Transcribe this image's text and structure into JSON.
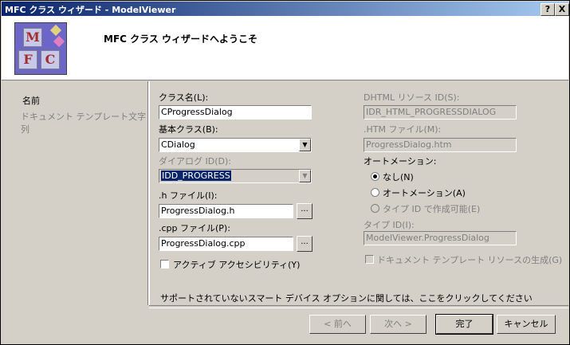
{
  "window": {
    "title": "MFC クラス ウィザード - ModelViewer",
    "help_button": "?",
    "close_button": "X"
  },
  "header": {
    "welcome": "MFC クラス ウィザードへようこそ",
    "logo_letters": [
      "M",
      "F",
      "C"
    ]
  },
  "sidebar": {
    "items": [
      {
        "label": "名前"
      },
      {
        "label": "ドキュメント テンプレート文字列"
      }
    ]
  },
  "form": {
    "class_name_label": "クラス名(L):",
    "class_name_value": "CProgressDialog",
    "base_class_label": "基本クラス(B):",
    "base_class_value": "CDialog",
    "dialog_id_label": "ダイアログ ID(D):",
    "dialog_id_value": "IDD_PROGRESS",
    "h_file_label": ".h ファイル(I):",
    "h_file_value": "ProgressDialog.h",
    "cpp_file_label": ".cpp ファイル(P):",
    "cpp_file_value": "ProgressDialog.cpp",
    "browse_label": "...",
    "accessibility_label": "アクティブ アクセシビリティ(Y)",
    "dhtml_id_label": "DHTML リソース ID(S):",
    "dhtml_id_value": "IDR_HTML_PROGRESSDIALOG",
    "htm_file_label": ".HTM ファイル(M):",
    "htm_file_value": "ProgressDialog.htm",
    "automation_label": "オートメーション:",
    "automation_options": [
      {
        "label": "なし(N)",
        "checked": true,
        "enabled": true
      },
      {
        "label": "オートメーション(A)",
        "checked": false,
        "enabled": true
      },
      {
        "label": "タイプ ID で作成可能(E)",
        "checked": false,
        "enabled": false
      }
    ],
    "type_id_label": "タイプ ID(I):",
    "type_id_value": "ModelViewer.ProgressDialog",
    "gen_doc_template_label": "ドキュメント テンプレート リソースの生成(G)",
    "unsupported_link": "サポートされていないスマート デバイス オプションに関しては、ここをクリックしてください"
  },
  "buttons": {
    "back": "< 前へ",
    "next": "次へ >",
    "finish": "完了",
    "cancel": "キャンセル"
  }
}
